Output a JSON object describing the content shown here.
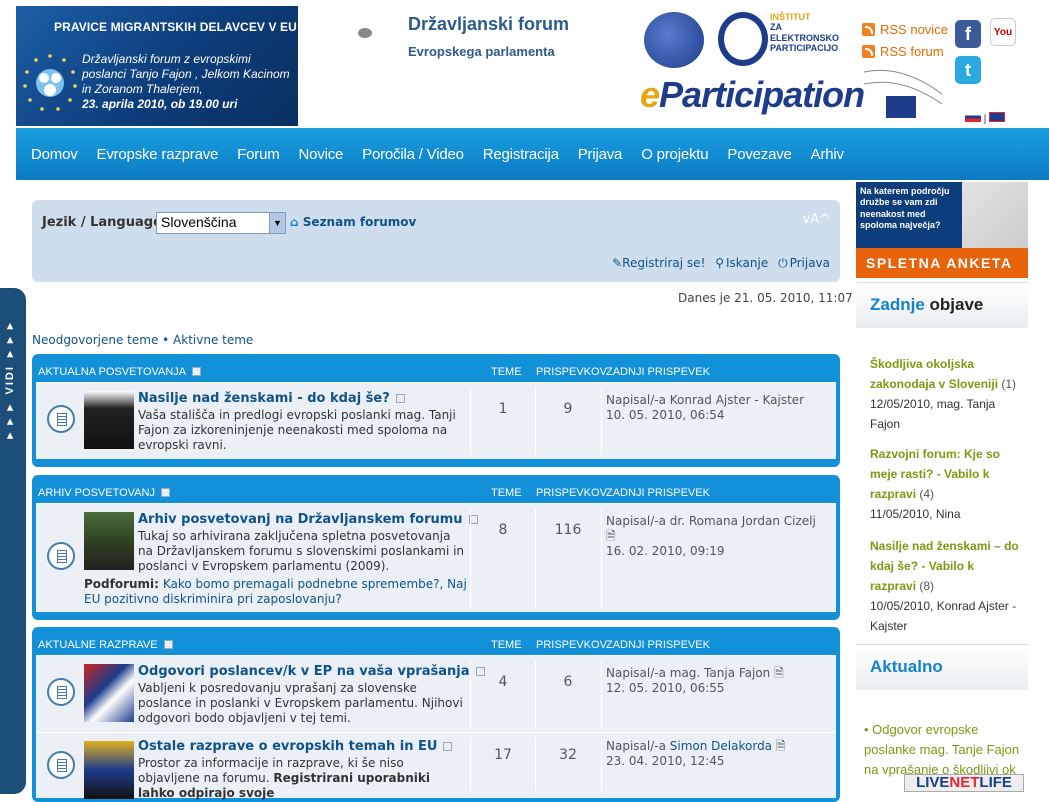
{
  "header": {
    "banner_title": "PRAVICE MIGRANTSKIH DELAVCEV V EU",
    "banner_text": "Državljanski forum z evropskimi poslanci Tanjo Fajon , Jelkom Kacinom in Zoranom Thalerjem,",
    "banner_date": "23. aprila 2010, ob 19.00 uri",
    "forum_title": "Državljanski forum",
    "forum_subtitle": "Evropskega parlamenta",
    "institute": "INŠTITUT ZA ELEKTRONSKO PARTICIPACIJO",
    "eparticipation": "Participation",
    "rss_news": "RSS novice",
    "rss_forum": "RSS forum"
  },
  "nav": {
    "items": [
      "Domov",
      "Evropske razprave",
      "Forum",
      "Novice",
      "Poročila / Video",
      "Registracija",
      "Prijava",
      "O projektu",
      "Povezave",
      "Arhiv"
    ]
  },
  "side_tab": "▼▼▼ VIDI ▼▼▼",
  "topbox": {
    "lang_label": "Jezik / Language:",
    "lang_value": "Slovenščina",
    "forum_list": "Seznam forumov",
    "register": "Registriraj se!",
    "search": "Iskanje",
    "login": "Prijava"
  },
  "date": "Danes je 21. 05. 2010, 11:07",
  "quick_links": "Neodgovorjene teme • Aktivne teme",
  "columns": {
    "topics": "TEME",
    "posts": "PRISPEVKOV",
    "last": "ZADNJI PRISPEVEK"
  },
  "categories": [
    {
      "name": "AKTUALNA POSVETOVANJA",
      "forums": [
        {
          "title": "Nasilje nad ženskami - do kdaj še?",
          "desc": "Vaša stališča in predlogi evropski poslanki mag. Tanji Fajon za izkoreninjenje neenakosti med spoloma na evropski ravni.",
          "topics": "1",
          "posts": "9",
          "last_by": "Napisal/-a Konrad Ajster - Kajster",
          "last_date": "10. 05. 2010, 06:54"
        }
      ]
    },
    {
      "name": "ARHIV POSVETOVANJ",
      "forums": [
        {
          "title": "Arhiv posvetovanj na Državljanskem forumu",
          "desc": "Tukaj so arhivirana zaključena spletna posvetovanja na Državljanskem forumu s slovenskimi poslankami in poslanci v Evropskem parlamentu (2009).",
          "subforums_label": "Podforumi:",
          "subforums": "Kako bomo premagali podnebne spremembe?,   Naj EU pozitivno diskriminira pri zaposlovanju?",
          "topics": "8",
          "posts": "116",
          "last_by": "Napisal/-a dr. Romana Jordan Cizelj",
          "last_date": "16. 02. 2010, 09:19"
        }
      ]
    },
    {
      "name": "AKTUALNE RAZPRAVE",
      "forums": [
        {
          "title": "Odgovori poslancev/k v EP na vaša vprašanja",
          "desc": "Vabljeni k posredovanju vprašanj za slovenske poslance in poslanki v Evropskem parlamentu. Njihovi odgovori bodo objavljeni v tej temi.",
          "topics": "4",
          "posts": "6",
          "last_by": "Napisal/-a mag. Tanja Fajon",
          "last_date": "12. 05. 2010, 06:55"
        },
        {
          "title": "Ostale razprave o evropskih temah in EU",
          "desc": "Prostor za informacije in razprave, ki še niso objavljene na forumu.",
          "desc_bold": "Registrirani uporabniki lahko odpirajo svoje",
          "topics": "17",
          "posts": "32",
          "last_by": "Napisal/-a Simon Delakorda",
          "last_date": "23. 04. 2010, 12:45"
        }
      ]
    }
  ],
  "sidebar": {
    "anketa_question": "Na katerem področju družbe se vam zdi neenakost med spoloma največja?",
    "anketa_button": "SPLETNA ANKETA",
    "latest_title_blue": "Zadnje",
    "latest_title_rest": "objave",
    "posts": [
      {
        "title": "Škodljiva okoljska zakonodaja v Sloveniji",
        "count": "(1)",
        "meta": "12/05/2010, mag. Tanja Fajon"
      },
      {
        "title": "Razvojni forum: Kje so meje rasti? - Vabilo k razpravi",
        "count": "(4)",
        "meta": "11/05/2010, Nina"
      },
      {
        "title": "Nasilje nad ženskami – do kdaj še? - Vabilo k razpravi",
        "count": "(8)",
        "meta": "10/05/2010, Konrad Ajster - Kajster"
      }
    ],
    "aktualno_title": "Aktualno",
    "aktualno_item": "Odgovor evropske poslanke mag. Tanje Fajon na vprašanje o škodljivi ok",
    "livenet": "LIVENETLIFE"
  }
}
